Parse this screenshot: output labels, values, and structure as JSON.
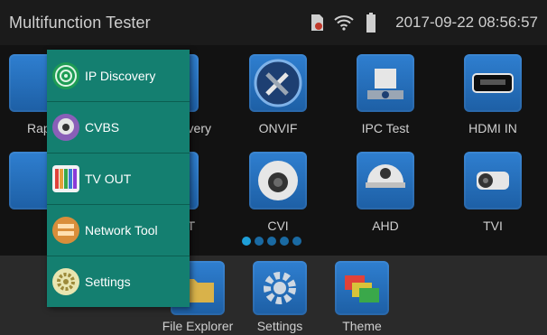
{
  "status": {
    "title": "Multifunction Tester",
    "datetime": "2017-09-22 08:56:57"
  },
  "grid_tiles": [
    {
      "label": "Rap",
      "icon": "rapid-icon"
    },
    {
      "label": "overy",
      "icon": "ip-discovery-icon"
    },
    {
      "label": "ONVIF",
      "icon": "onvif-tools-icon"
    },
    {
      "label": "IPC Test",
      "icon": "ipc-camera-icon"
    },
    {
      "label": "HDMI IN",
      "icon": "hdmi-icon"
    },
    {
      "label": "",
      "icon": "tv-out-icon"
    },
    {
      "label": "T",
      "icon": "tv-out-icon"
    },
    {
      "label": "CVI",
      "icon": "cvi-camera-icon"
    },
    {
      "label": "AHD",
      "icon": "ahd-camera-icon"
    },
    {
      "label": "TVI",
      "icon": "tvi-camera-icon"
    }
  ],
  "dock": [
    {
      "label": "File Explorer",
      "icon": "file-explorer-icon"
    },
    {
      "label": "Settings",
      "icon": "settings-gear-icon"
    },
    {
      "label": "Theme",
      "icon": "theme-icon"
    }
  ],
  "menu": [
    {
      "label": "IP Discovery",
      "icon": "ip-discovery-icon"
    },
    {
      "label": "CVBS",
      "icon": "cvbs-camera-icon"
    },
    {
      "label": "TV OUT",
      "icon": "tv-out-icon"
    },
    {
      "label": "Network Tool",
      "icon": "network-tool-icon"
    },
    {
      "label": "Settings",
      "icon": "settings-icon"
    }
  ],
  "pager": {
    "count": 5,
    "active_index": 0
  }
}
